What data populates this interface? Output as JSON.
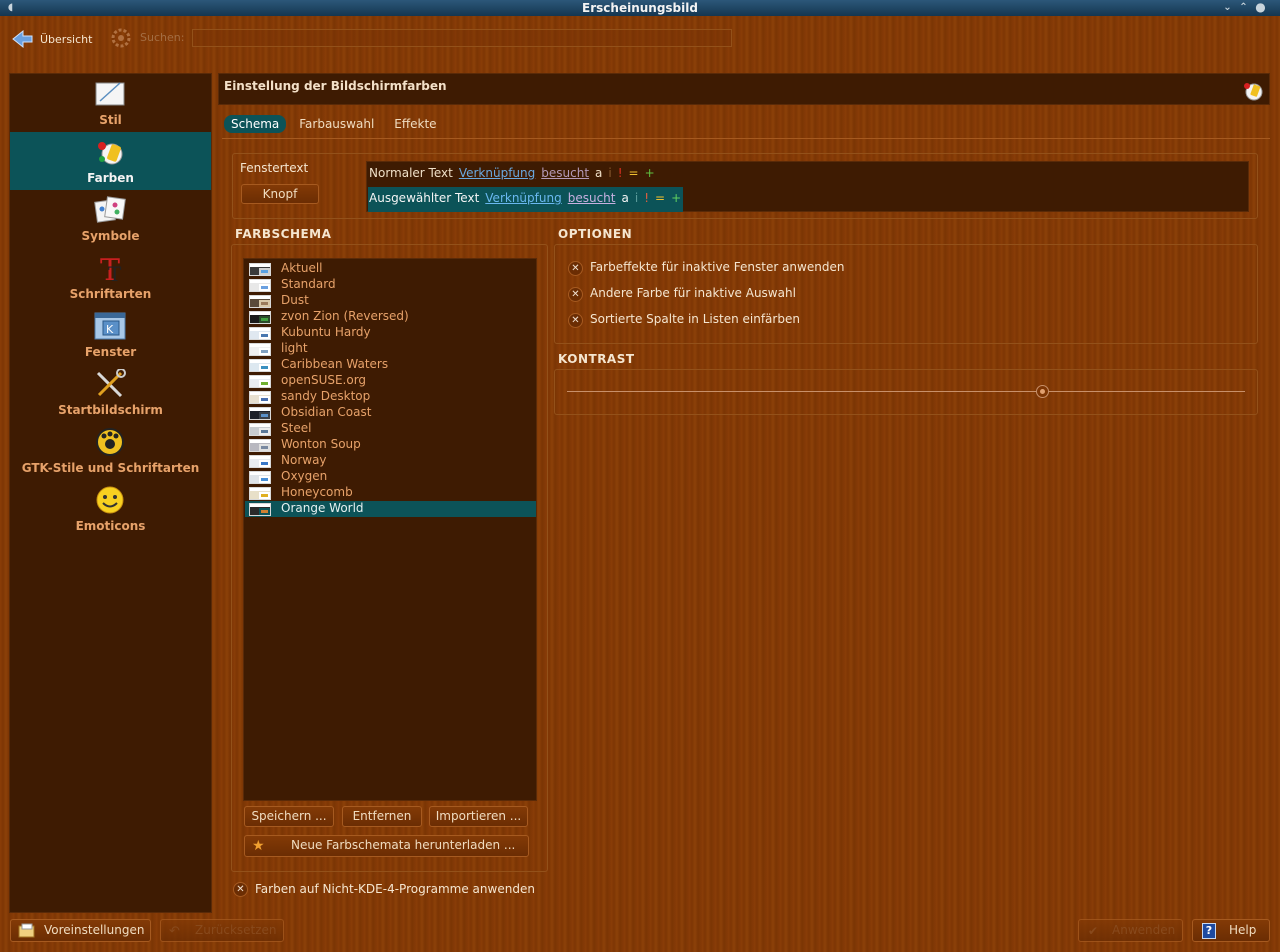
{
  "window": {
    "title": "Erscheinungsbild"
  },
  "toolbar": {
    "back_label": "Übersicht",
    "search_label": "Suchen:",
    "search_value": ""
  },
  "sidebar": {
    "items": [
      {
        "label": "Stil",
        "icon": "style-icon"
      },
      {
        "label": "Farben",
        "icon": "colors-icon",
        "active": true
      },
      {
        "label": "Symbole",
        "icon": "icons-icon"
      },
      {
        "label": "Schriftarten",
        "icon": "fonts-icon"
      },
      {
        "label": "Fenster",
        "icon": "window-icon"
      },
      {
        "label": "Startbildschirm",
        "icon": "splash-tools-icon"
      },
      {
        "label": "GTK-Stile und Schriftarten",
        "icon": "gtk-icon"
      },
      {
        "label": "Emoticons",
        "icon": "smiley-icon"
      }
    ]
  },
  "content": {
    "title": "Einstellung der Bildschirmfarben",
    "tabs": [
      "Schema",
      "Farbauswahl",
      "Effekte"
    ],
    "active_tab": "Schema"
  },
  "preview": {
    "window_text": "Fenstertext",
    "button": "Knopf",
    "normal": {
      "text": "Normaler Text",
      "link": "Verknüpfung",
      "visited": "besucht",
      "a": "a",
      "i": "i",
      "excl": "!",
      "eq": "=",
      "plus": "+"
    },
    "selected": {
      "text": "Ausgewählter Text",
      "link": "Verknüpfung",
      "visited": "besucht",
      "a": "a",
      "i": "i",
      "excl": "!",
      "eq": "=",
      "plus": "+"
    }
  },
  "schemes": {
    "header": "FARBSCHEMA",
    "items": [
      "Aktuell",
      "Standard",
      "Dust",
      "zvon Zion (Reversed)",
      "Kubuntu Hardy",
      "light",
      "Caribbean Waters",
      "openSUSE.org",
      "sandy Desktop",
      "Obsidian Coast",
      "Steel",
      "Wonton Soup",
      "Norway",
      "Oxygen",
      "Honeycomb",
      "Orange World"
    ],
    "selected": "Orange World",
    "buttons": {
      "save": "Speichern ...",
      "remove": "Entfernen",
      "import": "Importieren ...",
      "download": "Neue Farbschemata herunterladen ..."
    }
  },
  "options": {
    "header": "OPTIONEN",
    "items": [
      {
        "label": "Farbeffekte für inaktive Fenster anwenden",
        "checked": true
      },
      {
        "label": "Andere Farbe für inaktive Auswahl",
        "checked": true
      },
      {
        "label": "Sortierte Spalte in Listen einfärben",
        "checked": true
      }
    ]
  },
  "contrast": {
    "header": "KONTRAST",
    "value_fraction": 0.7
  },
  "apply_non_kde": {
    "label": "Farben auf Nicht-KDE-4-Programme anwenden",
    "checked": true
  },
  "bottom": {
    "defaults": "Voreinstellungen",
    "reset": "Zurücksetzen",
    "apply": "Anwenden",
    "help": "Help"
  },
  "colors": {
    "accent": "#0c5358",
    "panel": "#3e1b02",
    "bg": "#8a3d08",
    "link": "#6aa9e0"
  }
}
